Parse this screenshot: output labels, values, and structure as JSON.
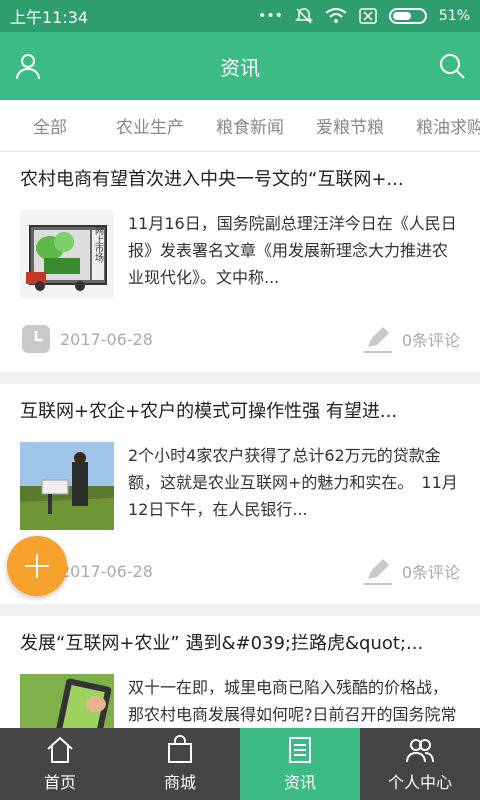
{
  "status_bar": {
    "time": "上午11:34",
    "battery": "51%"
  },
  "header": {
    "title": "资讯",
    "left_icon": "user-icon",
    "right_icon": "search-icon"
  },
  "tabs": [
    {
      "label": "全部"
    },
    {
      "label": "农业生产"
    },
    {
      "label": "粮食新闻"
    },
    {
      "label": "爱粮节粮"
    },
    {
      "label": "粮油求购"
    }
  ],
  "articles": [
    {
      "title": "农村电商有望首次进入中央一号文的“互联网+...",
      "summary": "11月16日，国务院副总理汪洋今日在《人民日报》发表署名文章《用发展新理念大力推进农业现代化》。文中称...",
      "date": "2017-06-28",
      "comments": "0条评论",
      "thumb_text": "网上市场"
    },
    {
      "title": "互联网+农企+农户的模式可操作性强 有望进...",
      "summary": "2个小时4家农户获得了总计62万元的贷款金额，这就是农业互联网+的魅力和实在。　11月12日下午，在人民银行...",
      "date": "2017-06-28",
      "comments": "0条评论"
    },
    {
      "title": "发展“互联网+农业” 遇到&#039;拦路虎&quot;...",
      "summary": "双十一在即，城里电商已陷入残酷的价格战，那农村电商发展得如何呢?日前召开的国务院常务会议部署加快发展农..."
    }
  ],
  "bottom_nav": [
    {
      "label": "首页",
      "icon": "home-icon"
    },
    {
      "label": "商城",
      "icon": "shopping-bag-icon"
    },
    {
      "label": "资讯",
      "icon": "news-icon",
      "active": true
    },
    {
      "label": "个人中心",
      "icon": "users-icon"
    }
  ],
  "colors": {
    "primary": "#3dbb85",
    "status_bar": "#2f9e6e",
    "fab": "#f5a12b",
    "nav_bg": "#454545"
  }
}
